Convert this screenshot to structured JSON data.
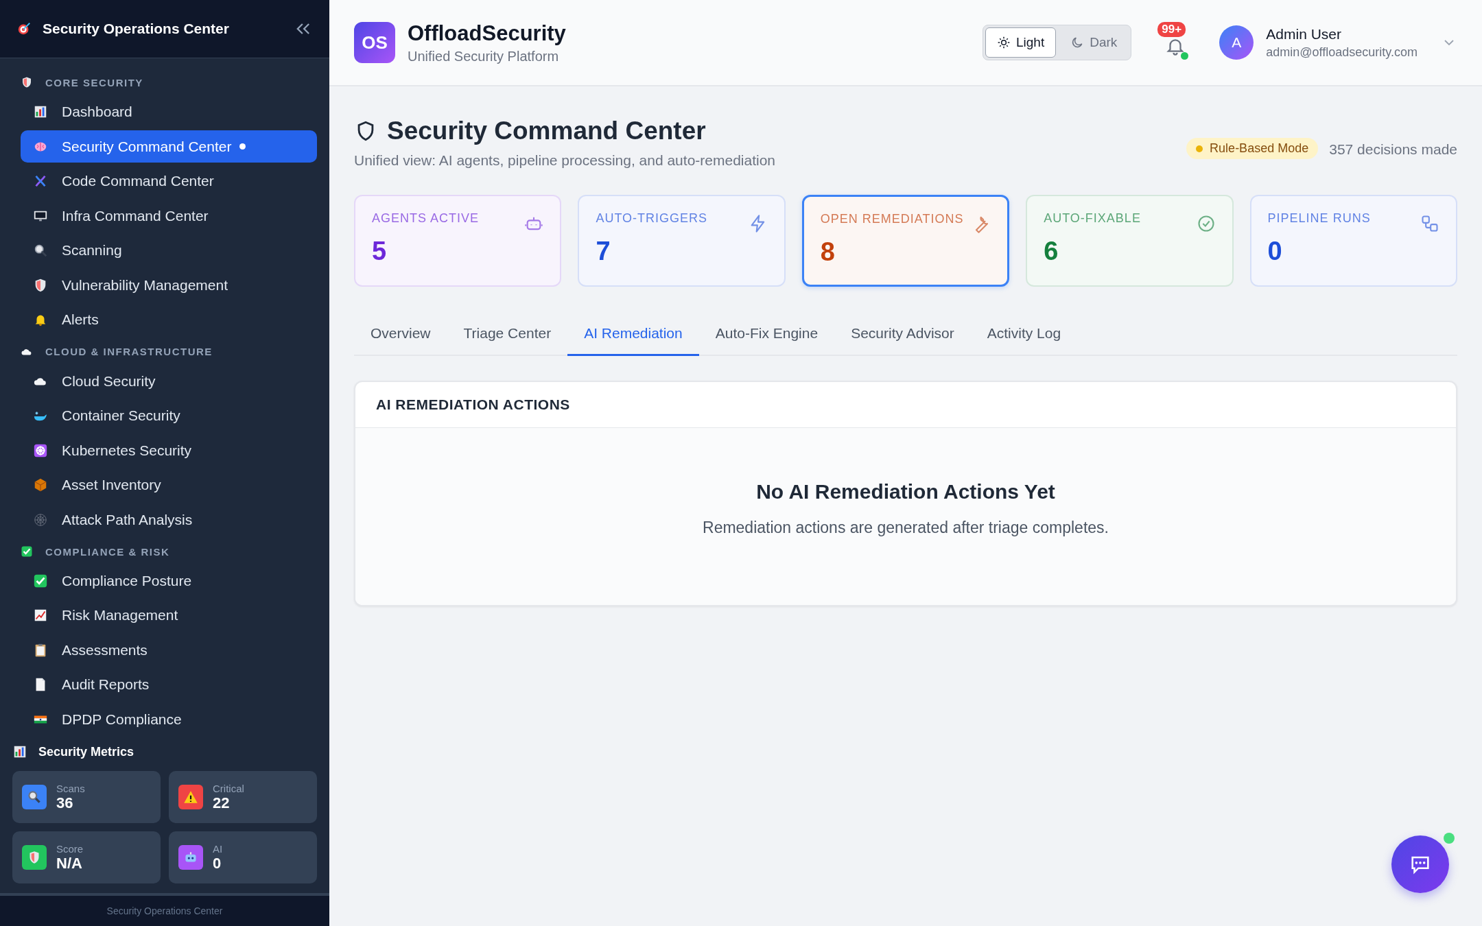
{
  "sidebar": {
    "title": "Security Operations Center",
    "sections": [
      {
        "label": "CORE SECURITY",
        "items": [
          {
            "label": "Dashboard",
            "selected": false
          },
          {
            "label": "Security Command Center",
            "selected": true
          },
          {
            "label": "Code Command Center",
            "selected": false
          },
          {
            "label": "Infra Command Center",
            "selected": false
          },
          {
            "label": "Scanning",
            "selected": false
          },
          {
            "label": "Vulnerability Management",
            "selected": false
          },
          {
            "label": "Alerts",
            "selected": false
          }
        ]
      },
      {
        "label": "CLOUD & INFRASTRUCTURE",
        "items": [
          {
            "label": "Cloud Security",
            "selected": false
          },
          {
            "label": "Container Security",
            "selected": false
          },
          {
            "label": "Kubernetes Security",
            "selected": false
          },
          {
            "label": "Asset Inventory",
            "selected": false
          },
          {
            "label": "Attack Path Analysis",
            "selected": false
          }
        ]
      },
      {
        "label": "COMPLIANCE & RISK",
        "items": [
          {
            "label": "Compliance Posture",
            "selected": false
          },
          {
            "label": "Risk Management",
            "selected": false
          },
          {
            "label": "Assessments",
            "selected": false
          },
          {
            "label": "Audit Reports",
            "selected": false
          },
          {
            "label": "DPDP Compliance",
            "selected": false
          }
        ]
      }
    ],
    "metrics": {
      "title": "Security Metrics",
      "tiles": [
        {
          "label": "Scans",
          "value": "36",
          "color": "#3b82f6"
        },
        {
          "label": "Critical",
          "value": "22",
          "color": "#ef4444"
        },
        {
          "label": "Score",
          "value": "N/A",
          "color": "#22c55e"
        },
        {
          "label": "AI",
          "value": "0",
          "color": "#a855f7"
        }
      ]
    },
    "footer": "Security Operations Center"
  },
  "header": {
    "logo": "OS",
    "brand": "OffloadSecurity",
    "tagline": "Unified Security Platform",
    "theme": [
      {
        "label": "Light",
        "selected": true
      },
      {
        "label": "Dark",
        "selected": false
      }
    ],
    "notifications": "99+",
    "user": {
      "initial": "A",
      "name": "Admin User",
      "email": "admin@offloadsecurity.com"
    }
  },
  "page": {
    "title": "Security Command Center",
    "subtitle": "Unified view: AI agents, pipeline processing, and auto-remediation",
    "mode": "Rule-Based Mode",
    "decisions": "357 decisions made"
  },
  "stats": [
    {
      "label": "AGENTS ACTIVE",
      "value": "5",
      "color": "#6d28d9",
      "selected": false
    },
    {
      "label": "AUTO-TRIGGERS",
      "value": "7",
      "color": "#1d4ed8",
      "selected": false
    },
    {
      "label": "OPEN REMEDIATIONS",
      "value": "8",
      "color": "#c2410c",
      "selected": true
    },
    {
      "label": "AUTO-FIXABLE",
      "value": "6",
      "color": "#15803d",
      "selected": false
    },
    {
      "label": "PIPELINE RUNS",
      "value": "0",
      "color": "#1d4ed8",
      "selected": false
    }
  ],
  "tabs": [
    {
      "label": "Overview",
      "selected": false
    },
    {
      "label": "Triage Center",
      "selected": false
    },
    {
      "label": "AI Remediation",
      "selected": true
    },
    {
      "label": "Auto-Fix Engine",
      "selected": false
    },
    {
      "label": "Security Advisor",
      "selected": false
    },
    {
      "label": "Activity Log",
      "selected": false
    }
  ],
  "panel": {
    "title": "AI REMEDIATION ACTIONS",
    "empty_title": "No AI Remediation Actions Yet",
    "empty_text": "Remediation actions are generated after triage completes."
  }
}
